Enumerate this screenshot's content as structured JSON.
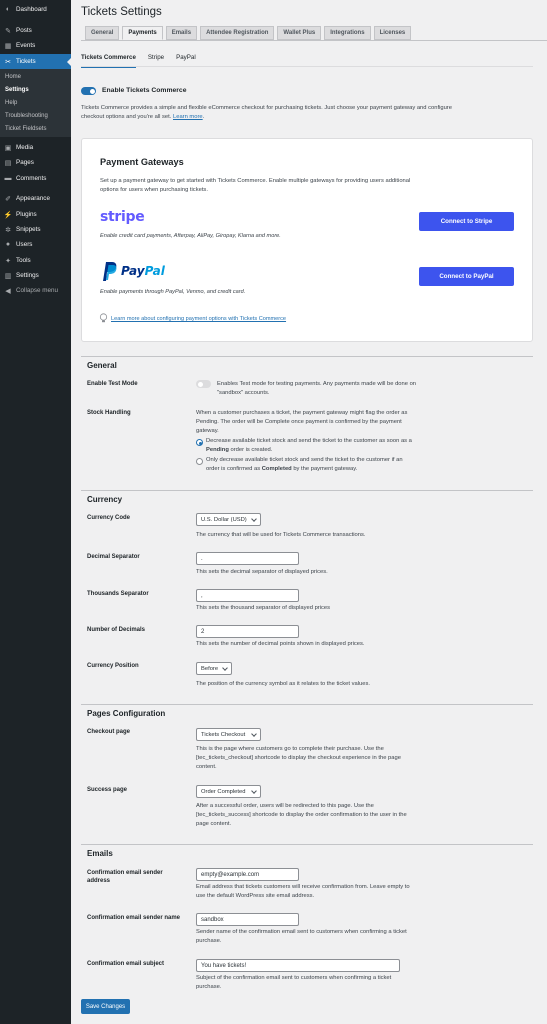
{
  "sidebar": {
    "items": [
      {
        "label": "Dashboard",
        "icon": "dashboard-icon",
        "glyph": "◐"
      },
      {
        "label": "Posts",
        "icon": "pin-icon",
        "glyph": "✎"
      },
      {
        "label": "Events",
        "icon": "calendar-icon",
        "glyph": "▦"
      },
      {
        "label": "Tickets",
        "icon": "ticket-icon",
        "glyph": "✂"
      },
      {
        "label": "Media",
        "icon": "media-icon",
        "glyph": "▣"
      },
      {
        "label": "Pages",
        "icon": "pages-icon",
        "glyph": "▤"
      },
      {
        "label": "Comments",
        "icon": "comment-icon",
        "glyph": "▬"
      },
      {
        "label": "Appearance",
        "icon": "brush-icon",
        "glyph": "✐"
      },
      {
        "label": "Plugins",
        "icon": "plugin-icon",
        "glyph": "⚡"
      },
      {
        "label": "Snippets",
        "icon": "snippets-icon",
        "glyph": "✲"
      },
      {
        "label": "Users",
        "icon": "users-icon",
        "glyph": "●"
      },
      {
        "label": "Tools",
        "icon": "wrench-icon",
        "glyph": "✦"
      },
      {
        "label": "Settings",
        "icon": "settings-icon",
        "glyph": "▥"
      },
      {
        "label": "Collapse menu",
        "icon": "collapse-icon",
        "glyph": "◀"
      }
    ],
    "submenu": [
      "Home",
      "Settings",
      "Help",
      "Troubleshooting",
      "Ticket Fieldsets"
    ]
  },
  "header": {
    "title": "Tickets Settings"
  },
  "tabs": [
    "General",
    "Payments",
    "Emails",
    "Attendee Registration",
    "Wallet Plus",
    "Integrations",
    "Licenses"
  ],
  "subtabs": [
    "Tickets Commerce",
    "Stripe",
    "PayPal"
  ],
  "enable": {
    "label": "Enable Tickets Commerce",
    "on": true
  },
  "intro": {
    "text": "Tickets Commerce provides a simple and flexible eCommerce checkout for purchasing tickets. Just choose your payment gateway and configure checkout options and you're all set.",
    "link": "Learn more"
  },
  "gateways": {
    "title": "Payment Gateways",
    "description": "Set up a payment gateway to get started with Tickets Commerce. Enable multiple gateways for providing users additional options for users when purchasing tickets.",
    "stripe": {
      "logo": "stripe",
      "desc": "Enable credit card payments, Afterpay, AliPay, Giropay, Klarna and more.",
      "button": "Connect to Stripe"
    },
    "paypal": {
      "logo_pay": "Pay",
      "logo_pal": "Pal",
      "desc": "Enable payments through PayPal, Venmo, and credit card.",
      "button": "Connect to PayPal"
    },
    "learn_more": "Learn more about configuring payment options with Tickets Commerce"
  },
  "general": {
    "title": "General",
    "test_mode": {
      "label": "Enable Test Mode",
      "desc": "Enables Test mode for testing payments. Any payments made will be done on \"sandbox\" accounts.",
      "on": false
    },
    "stock": {
      "label": "Stock Handling",
      "desc": "When a customer purchases a ticket, the payment gateway might flag the order as Pending. The order will be Complete once payment is confirmed by the payment gateway.",
      "option1_a": "Decrease available ticket stock and send the ticket to the customer as soon as a ",
      "option1_b": "Pending",
      "option1_c": " order is created.",
      "option2_a": "Only decrease available ticket stock and send the ticket to the customer if an order is confirmed as ",
      "option2_b": "Completed",
      "option2_c": " by the payment gateway."
    }
  },
  "currency": {
    "title": "Currency",
    "code": {
      "label": "Currency Code",
      "value": "U.S. Dollar (USD)",
      "desc": "The currency that will be used for Tickets Commerce transactions."
    },
    "decimal": {
      "label": "Decimal Separator",
      "value": ".",
      "desc": "This sets the decimal separator of displayed prices."
    },
    "thousands": {
      "label": "Thousands Separator",
      "value": ",",
      "desc": "This sets the thousand separator of displayed prices"
    },
    "decimals": {
      "label": "Number of Decimals",
      "value": "2",
      "desc": "This sets the number of decimal points shown in displayed prices."
    },
    "position": {
      "label": "Currency Position",
      "value": "Before",
      "desc": "The position of the currency symbol as it relates to the ticket values."
    }
  },
  "pages": {
    "title": "Pages Configuration",
    "checkout": {
      "label": "Checkout page",
      "value": "Tickets Checkout",
      "desc": "This is the page where customers go to complete their purchase. Use the [tec_tickets_checkout] shortcode to display the checkout experience in the page content."
    },
    "success": {
      "label": "Success page",
      "value": "Order Completed",
      "desc": "After a successful order, users will be redirected to this page. Use the [tec_tickets_success] shortcode to display the order confirmation to the user in the page content."
    }
  },
  "emails": {
    "title": "Emails",
    "sender_address": {
      "label": "Confirmation email sender address",
      "value": "empty@example.com",
      "desc": "Email address that tickets customers will receive confirmation from. Leave empty to use the default WordPress site email address."
    },
    "sender_name": {
      "label": "Confirmation email sender name",
      "value": "sandbox",
      "desc": "Sender name of the confirmation email sent to customers when confirming a ticket purchase."
    },
    "subject": {
      "label": "Confirmation email subject",
      "value": "You have tickets!",
      "desc": "Subject of the confirmation email sent to customers when confirming a ticket purchase."
    }
  },
  "save_label": "Save Changes",
  "colors": {
    "accent": "#2271b1",
    "connect_button": "#3d54ee",
    "sidebar": "#1d2327",
    "stripe": "#635bff"
  }
}
